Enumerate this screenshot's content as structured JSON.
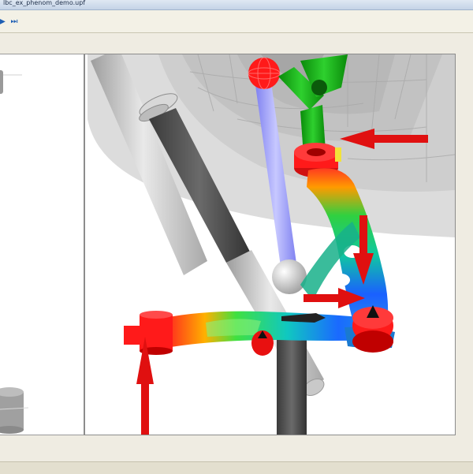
{
  "window": {
    "title": "lbc_ex_phenom_demo.upf"
  },
  "toolbar": {
    "play_icon": "play-icon",
    "skip_end_icon": "skip-to-end-icon",
    "play_glyph": "▶",
    "skip_glyph": "⏭"
  },
  "colors": {
    "accent": "#1e5fb4",
    "load_arrow": "#e01010",
    "pushrod": "#9a9cf0",
    "upright": "#18b018",
    "damper_body": "#444444",
    "wheel_ghost": "#bdbdbd"
  }
}
